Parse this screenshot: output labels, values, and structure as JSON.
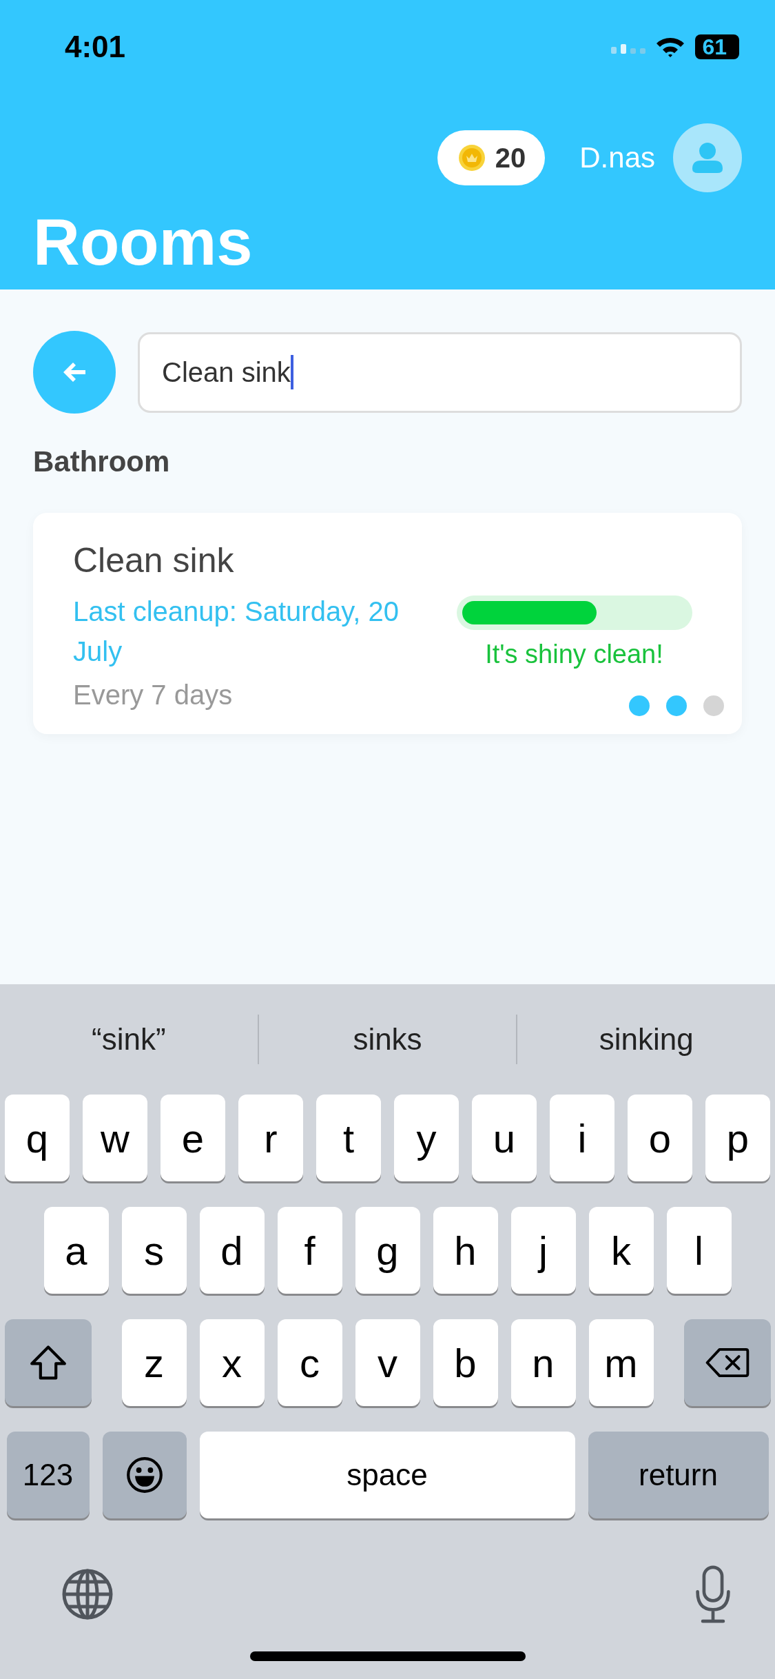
{
  "status_bar": {
    "time": "4:01",
    "battery": "61"
  },
  "header": {
    "coins": "20",
    "user": "D.nas",
    "title": "Rooms"
  },
  "search": {
    "value": "Clean sink"
  },
  "section": "Bathroom",
  "tasks": [
    {
      "title": "Clean sink",
      "last_cleanup": "Last cleanup: Saturday, 20 July",
      "frequency": "Every 7 days",
      "level": 0.6,
      "status": "It's shiny clean!",
      "dots": [
        {
          "on": true
        },
        {
          "on": true
        },
        {
          "on": false
        }
      ]
    }
  ],
  "keyboard": {
    "suggestions": [
      "“sink”",
      "sinks",
      "sinking"
    ],
    "rows": [
      {
        "keys": [
          {
            "kind": "letter",
            "label": "q"
          },
          {
            "kind": "letter",
            "label": "w"
          },
          {
            "kind": "letter",
            "label": "e"
          },
          {
            "kind": "letter",
            "label": "r"
          },
          {
            "kind": "letter",
            "label": "t"
          },
          {
            "kind": "letter",
            "label": "y"
          },
          {
            "kind": "letter",
            "label": "u"
          },
          {
            "kind": "letter",
            "label": "i"
          },
          {
            "kind": "letter",
            "label": "o"
          },
          {
            "kind": "letter",
            "label": "p"
          }
        ]
      },
      {
        "keys": [
          {
            "kind": "letter",
            "label": "a"
          },
          {
            "kind": "letter",
            "label": "s"
          },
          {
            "kind": "letter",
            "label": "d"
          },
          {
            "kind": "letter",
            "label": "f"
          },
          {
            "kind": "letter",
            "label": "g"
          },
          {
            "kind": "letter",
            "label": "h"
          },
          {
            "kind": "letter",
            "label": "j"
          },
          {
            "kind": "letter",
            "label": "k"
          },
          {
            "kind": "letter",
            "label": "l"
          }
        ]
      },
      {
        "keys": [
          {
            "kind": "shift"
          },
          {
            "kind": "letter",
            "label": "z"
          },
          {
            "kind": "letter",
            "label": "x"
          },
          {
            "kind": "letter",
            "label": "c"
          },
          {
            "kind": "letter",
            "label": "v"
          },
          {
            "kind": "letter",
            "label": "b"
          },
          {
            "kind": "letter",
            "label": "n"
          },
          {
            "kind": "letter",
            "label": "m"
          },
          {
            "kind": "delete"
          }
        ]
      },
      {
        "keys": [
          {
            "kind": "numbers",
            "label": "123"
          },
          {
            "kind": "emoji"
          },
          {
            "kind": "space",
            "label": "space"
          },
          {
            "kind": "return",
            "label": "return"
          }
        ]
      }
    ]
  }
}
